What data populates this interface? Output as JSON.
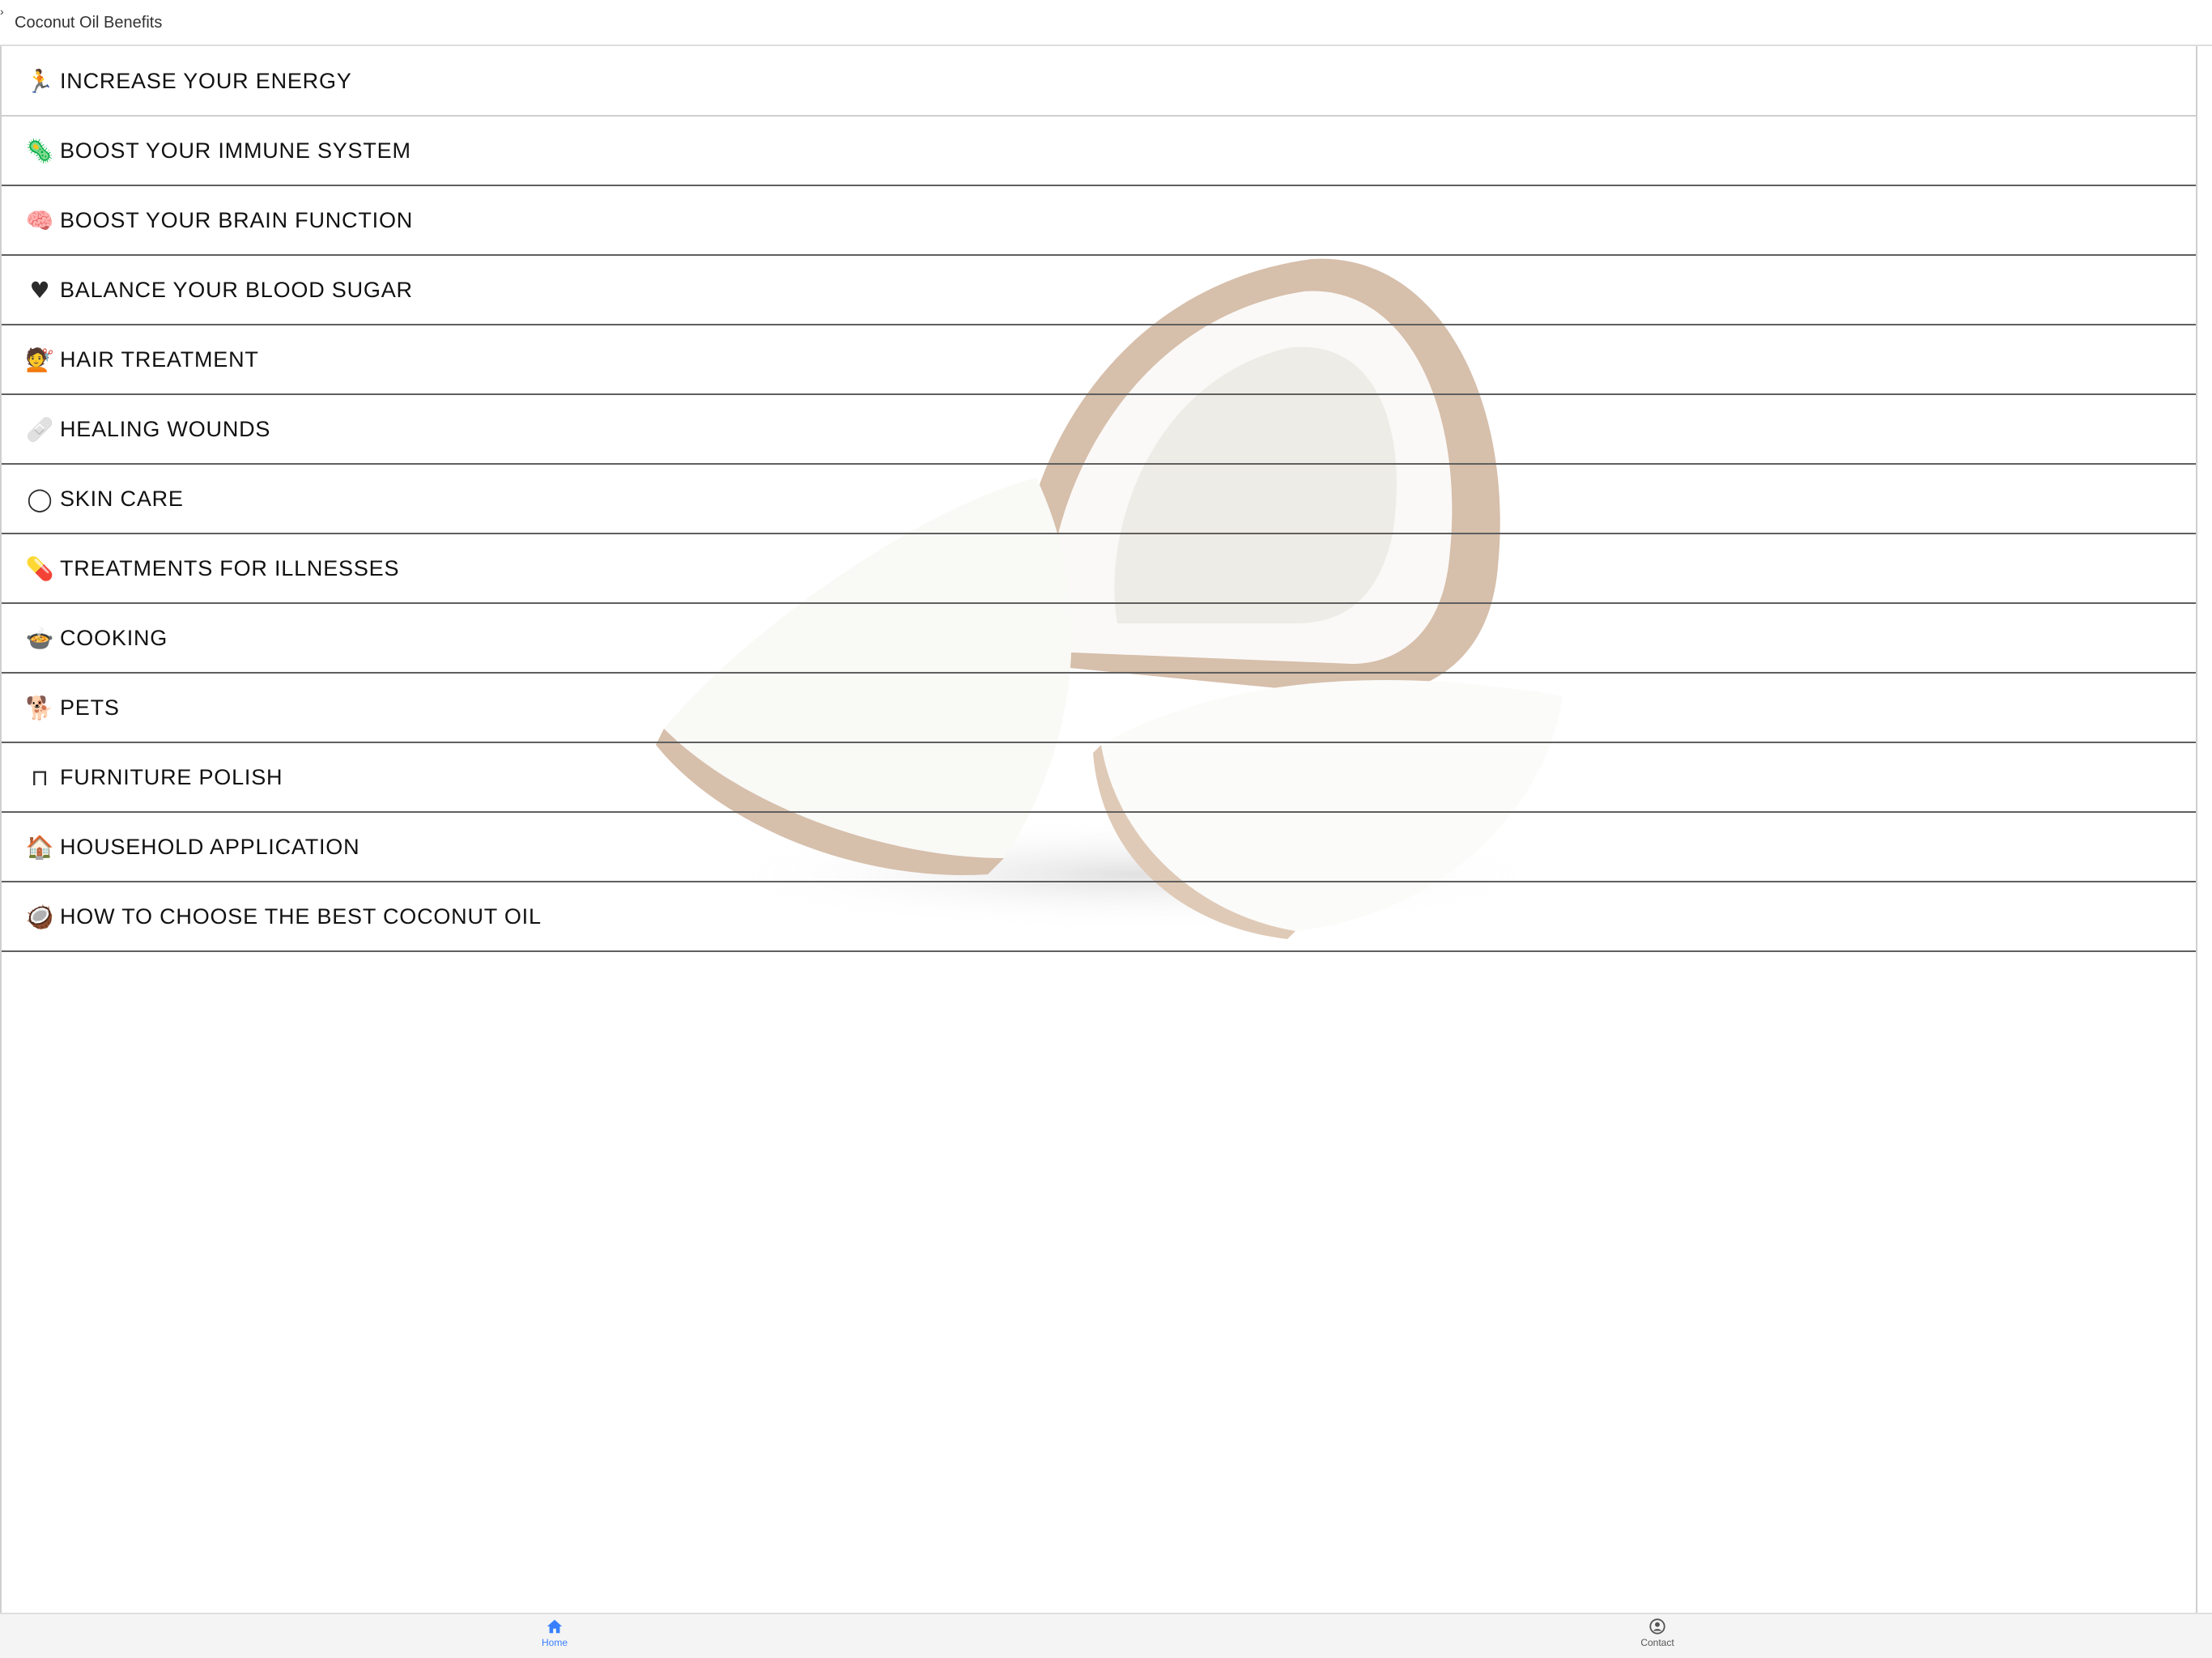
{
  "app": {
    "title": "Coconut Oil Benefits",
    "accent_color": "#3880ff"
  },
  "menu": {
    "items": [
      {
        "label": "INCREASE YOUR ENERGY",
        "icon": "treadmill-icon",
        "glyph": "🏃"
      },
      {
        "label": "BOOST YOUR IMMUNE SYSTEM",
        "icon": "virus-icon",
        "glyph": "🦠"
      },
      {
        "label": "BOOST YOUR BRAIN FUNCTION",
        "icon": "brain-icon",
        "glyph": "🧠"
      },
      {
        "label": "BALANCE YOUR BLOOD SUGAR",
        "icon": "heart-icon",
        "glyph": "♥"
      },
      {
        "label": "HAIR TREATMENT",
        "icon": "hair-icon",
        "glyph": "💇"
      },
      {
        "label": "HEALING WOUNDS",
        "icon": "bandage-icon",
        "glyph": "🩹"
      },
      {
        "label": "SKIN CARE",
        "icon": "skin-icon",
        "glyph": "◯"
      },
      {
        "label": "TREATMENTS FOR ILLNESSES",
        "icon": "medicine-bottle-icon",
        "glyph": "💊"
      },
      {
        "label": "COOKING",
        "icon": "cooking-pot-icon",
        "glyph": "🍲"
      },
      {
        "label": "PETS",
        "icon": "pet-icon",
        "glyph": "🐕"
      },
      {
        "label": "FURNITURE POLISH",
        "icon": "table-icon",
        "glyph": "⊓"
      },
      {
        "label": "HOUSEHOLD APPLICATION",
        "icon": "house-icon",
        "glyph": "🏠"
      },
      {
        "label": "HOW TO CHOOSE THE BEST COCONUT OIL",
        "icon": "coconut-icon",
        "glyph": "🥥"
      }
    ]
  },
  "tabs": {
    "home": {
      "label": "Home",
      "icon": "home-icon"
    },
    "contact": {
      "label": "Contact",
      "icon": "person-circle-icon"
    }
  }
}
